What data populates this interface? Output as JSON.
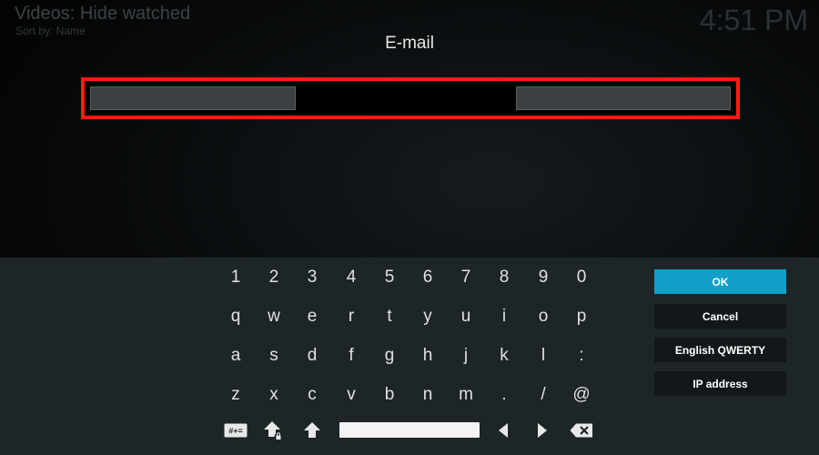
{
  "background": {
    "title": "Videos: Hide watched",
    "sort": "Sort by: Name",
    "clock": "4:51 PM"
  },
  "dialog": {
    "heading": "E-mail",
    "input_value": ""
  },
  "keyboard": {
    "rows": [
      [
        "1",
        "2",
        "3",
        "4",
        "5",
        "6",
        "7",
        "8",
        "9",
        "0"
      ],
      [
        "q",
        "w",
        "e",
        "r",
        "t",
        "y",
        "u",
        "i",
        "o",
        "p"
      ],
      [
        "a",
        "s",
        "d",
        "f",
        "g",
        "h",
        "j",
        "k",
        "l",
        ":"
      ],
      [
        "z",
        "x",
        "c",
        "v",
        "b",
        "n",
        "m",
        ".",
        "/",
        "@"
      ]
    ],
    "special_keys": [
      "symbols-key",
      "shift-lock-key",
      "shift-key",
      "space-key",
      "cursor-left-key",
      "cursor-right-key",
      "backspace-key"
    ],
    "symbols_label": "#+="
  },
  "buttons": {
    "ok": "OK",
    "cancel": "Cancel",
    "layout": "English QWERTY",
    "ip": "IP address"
  },
  "colors": {
    "accent": "#12a0c8",
    "highlight_border": "#ff1a12",
    "panel": "#1e2528"
  }
}
